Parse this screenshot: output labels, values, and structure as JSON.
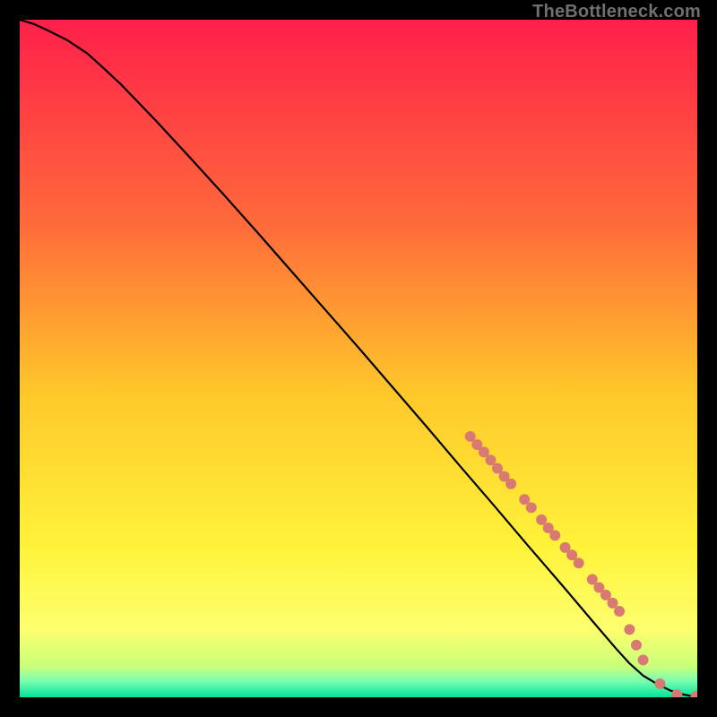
{
  "watermark": "TheBottleneck.com",
  "chart_data": {
    "type": "line",
    "title": "",
    "xlabel": "",
    "ylabel": "",
    "xlim": [
      0,
      100
    ],
    "ylim": [
      0,
      100
    ],
    "legend": false,
    "grid": false,
    "background_gradient": {
      "stops": [
        {
          "offset": 0.0,
          "color": "#ff1f4a"
        },
        {
          "offset": 0.3,
          "color": "#ff6a3a"
        },
        {
          "offset": 0.55,
          "color": "#ffc72a"
        },
        {
          "offset": 0.78,
          "color": "#fff33a"
        },
        {
          "offset": 0.9,
          "color": "#fdff6e"
        },
        {
          "offset": 0.955,
          "color": "#c8ff7a"
        },
        {
          "offset": 0.975,
          "color": "#7dffb0"
        },
        {
          "offset": 1.0,
          "color": "#00e59a"
        }
      ]
    },
    "series": [
      {
        "name": "curve",
        "color": "#000000",
        "width": 2.2,
        "x": [
          0,
          2,
          4,
          7,
          10,
          12,
          15,
          20,
          25,
          30,
          35,
          40,
          45,
          50,
          55,
          60,
          65,
          70,
          75,
          80,
          85,
          88,
          90,
          92,
          94,
          96,
          97.5,
          99,
          100
        ],
        "y": [
          100,
          99.4,
          98.5,
          97.0,
          95.0,
          93.2,
          90.4,
          85.2,
          79.8,
          74.3,
          68.7,
          63.0,
          57.3,
          51.6,
          45.8,
          40.0,
          34.1,
          28.3,
          22.4,
          16.6,
          10.7,
          7.2,
          5.0,
          3.2,
          2.0,
          1.0,
          0.5,
          0.2,
          0.15
        ]
      }
    ],
    "markers": {
      "name": "dots",
      "color": "#d87a72",
      "radius": 6,
      "points": [
        {
          "x": 66.5,
          "y": 38.5
        },
        {
          "x": 67.5,
          "y": 37.3
        },
        {
          "x": 68.5,
          "y": 36.2
        },
        {
          "x": 69.5,
          "y": 35.0
        },
        {
          "x": 70.5,
          "y": 33.8
        },
        {
          "x": 71.5,
          "y": 32.6
        },
        {
          "x": 72.5,
          "y": 31.5
        },
        {
          "x": 74.5,
          "y": 29.2
        },
        {
          "x": 75.5,
          "y": 28.0
        },
        {
          "x": 77.0,
          "y": 26.2
        },
        {
          "x": 78.0,
          "y": 25.0
        },
        {
          "x": 79.0,
          "y": 23.9
        },
        {
          "x": 80.5,
          "y": 22.1
        },
        {
          "x": 81.5,
          "y": 21.0
        },
        {
          "x": 82.5,
          "y": 19.8
        },
        {
          "x": 84.5,
          "y": 17.4
        },
        {
          "x": 85.5,
          "y": 16.2
        },
        {
          "x": 86.5,
          "y": 15.1
        },
        {
          "x": 87.5,
          "y": 13.9
        },
        {
          "x": 88.5,
          "y": 12.7
        },
        {
          "x": 90.0,
          "y": 10.0
        },
        {
          "x": 91.0,
          "y": 7.7
        },
        {
          "x": 92.0,
          "y": 5.5
        },
        {
          "x": 94.5,
          "y": 2.0
        },
        {
          "x": 97.0,
          "y": 0.4
        },
        {
          "x": 99.8,
          "y": 0.15
        }
      ]
    }
  }
}
